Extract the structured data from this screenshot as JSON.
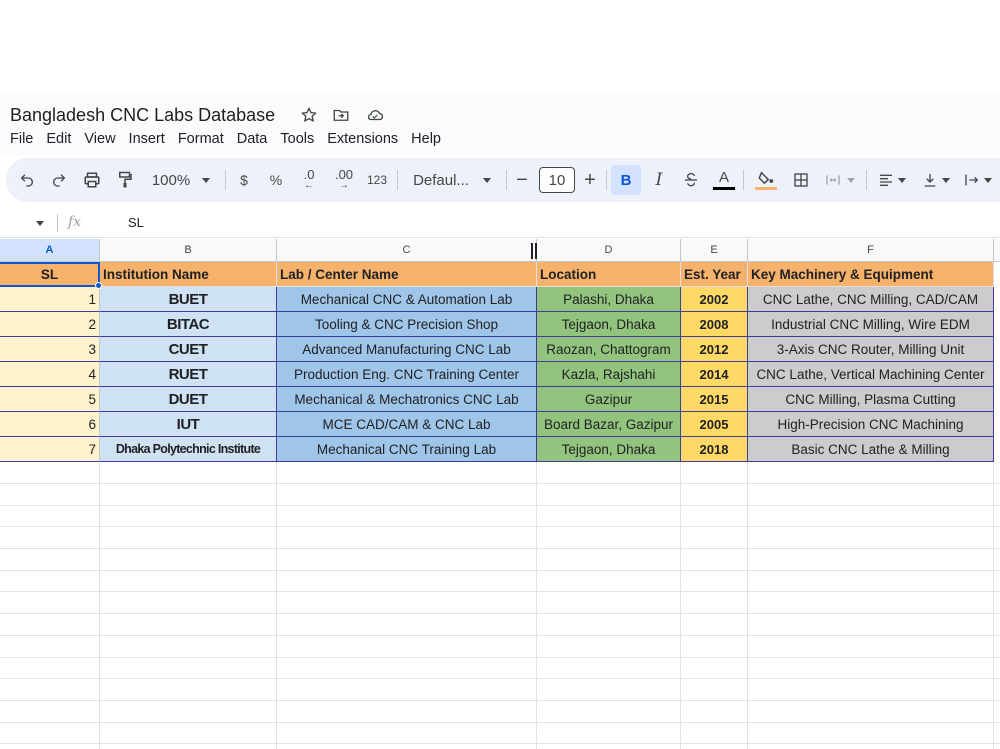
{
  "title": "Bangladesh CNC Labs Database",
  "title_icons": [
    "star-icon",
    "move-to-folder-icon",
    "cloud-status-icon"
  ],
  "menu": [
    "File",
    "Edit",
    "View",
    "Insert",
    "Format",
    "Data",
    "Tools",
    "Extensions",
    "Help"
  ],
  "toolbar": {
    "zoom": "100%",
    "currency": "$",
    "percent": "%",
    "decrease_decimal": ".0",
    "increase_decimal": ".00",
    "number_format": "123",
    "font": "Defaul...",
    "font_size": "10",
    "bold": "B",
    "italic": "I",
    "text_color_letter": "A"
  },
  "formula_bar": {
    "fx": "fx",
    "value": "SL"
  },
  "columns": [
    "A",
    "B",
    "C",
    "D",
    "E",
    "F"
  ],
  "header_row": [
    "SL",
    "Institution Name",
    "Lab / Center Name",
    "Location",
    "Est. Year",
    "Key Machinery & Equipment"
  ],
  "rows": [
    [
      "1",
      "BUET",
      "Mechanical CNC & Automation Lab",
      "Palashi, Dhaka",
      "2002",
      "CNC Lathe, CNC Milling, CAD/CAM"
    ],
    [
      "2",
      "BITAC",
      "Tooling & CNC Precision Shop",
      "Tejgaon, Dhaka",
      "2008",
      "Industrial CNC Milling, Wire EDM"
    ],
    [
      "3",
      "CUET",
      "Advanced Manufacturing CNC Lab",
      "Raozan, Chattogram",
      "2012",
      "3-Axis CNC Router, Milling Unit"
    ],
    [
      "4",
      "RUET",
      "Production Eng. CNC Training Center",
      "Kazla, Rajshahi",
      "2014",
      "CNC Lathe, Vertical Machining Center"
    ],
    [
      "5",
      "DUET",
      "Mechanical & Mechatronics CNC Lab",
      "Gazipur",
      "2015",
      "CNC Milling, Plasma Cutting"
    ],
    [
      "6",
      "IUT",
      "MCE CAD/CAM & CNC Lab",
      "Board Bazar, Gazipur",
      "2005",
      "High-Precision CNC Machining"
    ],
    [
      "7",
      "Dhaka Polytechnic Institute",
      "Mechanical CNC Training Lab",
      "Tejgaon, Dhaka",
      "2018",
      "Basic CNC Lathe & Milling"
    ]
  ],
  "colors": {
    "header_bg": "#f6b26b",
    "col_a_bg": "#fff2cc",
    "col_b_bg": "#cfe2f3",
    "col_c_bg": "#9fc5e8",
    "col_d_bg": "#93c47d",
    "col_e_bg": "#ffd966",
    "col_f_bg": "#cccccc",
    "selection": "#0b57d0"
  }
}
